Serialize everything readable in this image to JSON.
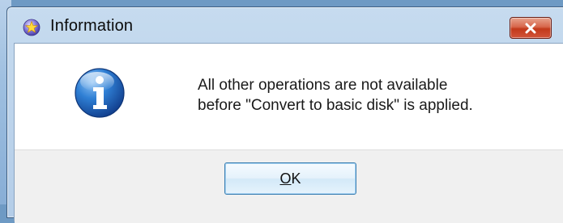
{
  "dialog": {
    "title": "Information",
    "title_icon": "app-star-icon",
    "close_icon": "close-icon",
    "message_line1": "All other operations are not available",
    "message_line2": "before \"Convert to basic disk\" is applied.",
    "info_icon": "information-icon",
    "ok_button": {
      "mnemonic": "O",
      "rest": "K"
    }
  },
  "colors": {
    "title_bar": "#c6dbef",
    "close_button": "#c2391b",
    "info_icon_blue": "#1f6fc7",
    "footer": "#f0f0f0",
    "ok_border": "#3c7fb1"
  }
}
